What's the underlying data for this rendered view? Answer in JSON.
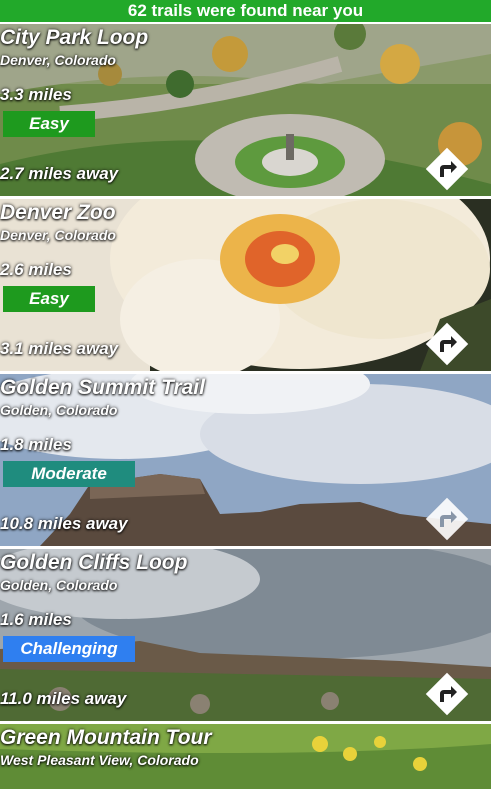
{
  "banner": {
    "text": "62 trails were found near you",
    "color": "#22a92a"
  },
  "colors": {
    "easy": "#1e9a1e",
    "moderate": "#1f8c7e",
    "challenging": "#2f7ff0"
  },
  "trails": [
    {
      "name": "City Park Loop",
      "location": "Denver, Colorado",
      "length": "3.3 miles",
      "difficulty": "Easy",
      "distance": "2.7 miles away",
      "photo": "aerial park with monument"
    },
    {
      "name": "Denver Zoo",
      "location": "Denver, Colorado",
      "length": "2.6 miles",
      "difficulty": "Easy",
      "distance": "3.1 miles away",
      "photo": "white flower closeup"
    },
    {
      "name": "Golden Summit Trail",
      "location": "Golden, Colorado",
      "length": "1.8 miles",
      "difficulty": "Moderate",
      "distance": "10.8 miles away",
      "photo": "mesa under cloudy sky"
    },
    {
      "name": "Golden Cliffs Loop",
      "location": "Golden, Colorado",
      "length": "1.6 miles",
      "difficulty": "Challenging",
      "distance": "11.0 miles away",
      "photo": "cliffs under storm clouds"
    },
    {
      "name": "Green Mountain Tour",
      "location": "West Pleasant View, Colorado",
      "length": "",
      "difficulty": "",
      "distance": "",
      "photo": "green meadow with yellow flowers"
    }
  ]
}
